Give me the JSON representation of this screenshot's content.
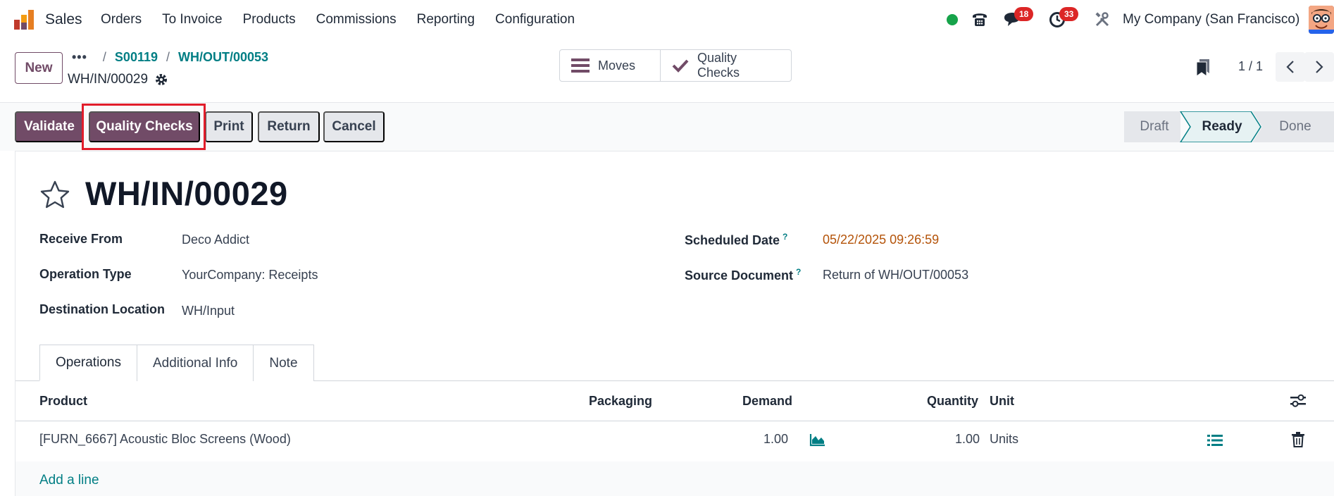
{
  "navbar": {
    "app_name": "Sales",
    "menu": [
      "Orders",
      "To Invoice",
      "Products",
      "Commissions",
      "Reporting",
      "Configuration"
    ],
    "messages_count": "18",
    "activities_count": "33",
    "company": "My Company (San Francisco)"
  },
  "control_panel": {
    "new_label": "New",
    "breadcrumb": [
      "S00119",
      "WH/OUT/00053"
    ],
    "record_name": "WH/IN/00029",
    "smart_buttons": {
      "moves": "Moves",
      "quality_checks": "Quality Checks"
    },
    "pager": "1 / 1"
  },
  "actions": {
    "validate": "Validate",
    "quality_checks": "Quality Checks",
    "print": "Print",
    "return": "Return",
    "cancel": "Cancel"
  },
  "statusbar": {
    "stages": [
      "Draft",
      "Ready",
      "Done"
    ],
    "current": "Ready"
  },
  "form": {
    "title": "WH/IN/00029",
    "receive_from_label": "Receive From",
    "receive_from": "Deco Addict",
    "operation_type_label": "Operation Type",
    "operation_type": "YourCompany: Receipts",
    "destination_label": "Destination Location",
    "destination": "WH/Input",
    "scheduled_date_label": "Scheduled Date",
    "scheduled_date": "05/22/2025 09:26:59",
    "source_document_label": "Source Document",
    "source_document": "Return of WH/OUT/00053",
    "help_mark": "?"
  },
  "tabs": [
    "Operations",
    "Additional Info",
    "Note"
  ],
  "table": {
    "headers": {
      "product": "Product",
      "packaging": "Packaging",
      "demand": "Demand",
      "quantity": "Quantity",
      "unit": "Unit"
    },
    "rows": [
      {
        "product": "[FURN_6667] Acoustic Bloc Screens (Wood)",
        "packaging": "",
        "demand": "1.00",
        "quantity": "1.00",
        "unit": "Units"
      }
    ],
    "add_line": "Add a line"
  },
  "colors": {
    "primary": "#714b67",
    "link": "#017e84",
    "highlight": "#e11d2b",
    "warning": "#b45309"
  }
}
